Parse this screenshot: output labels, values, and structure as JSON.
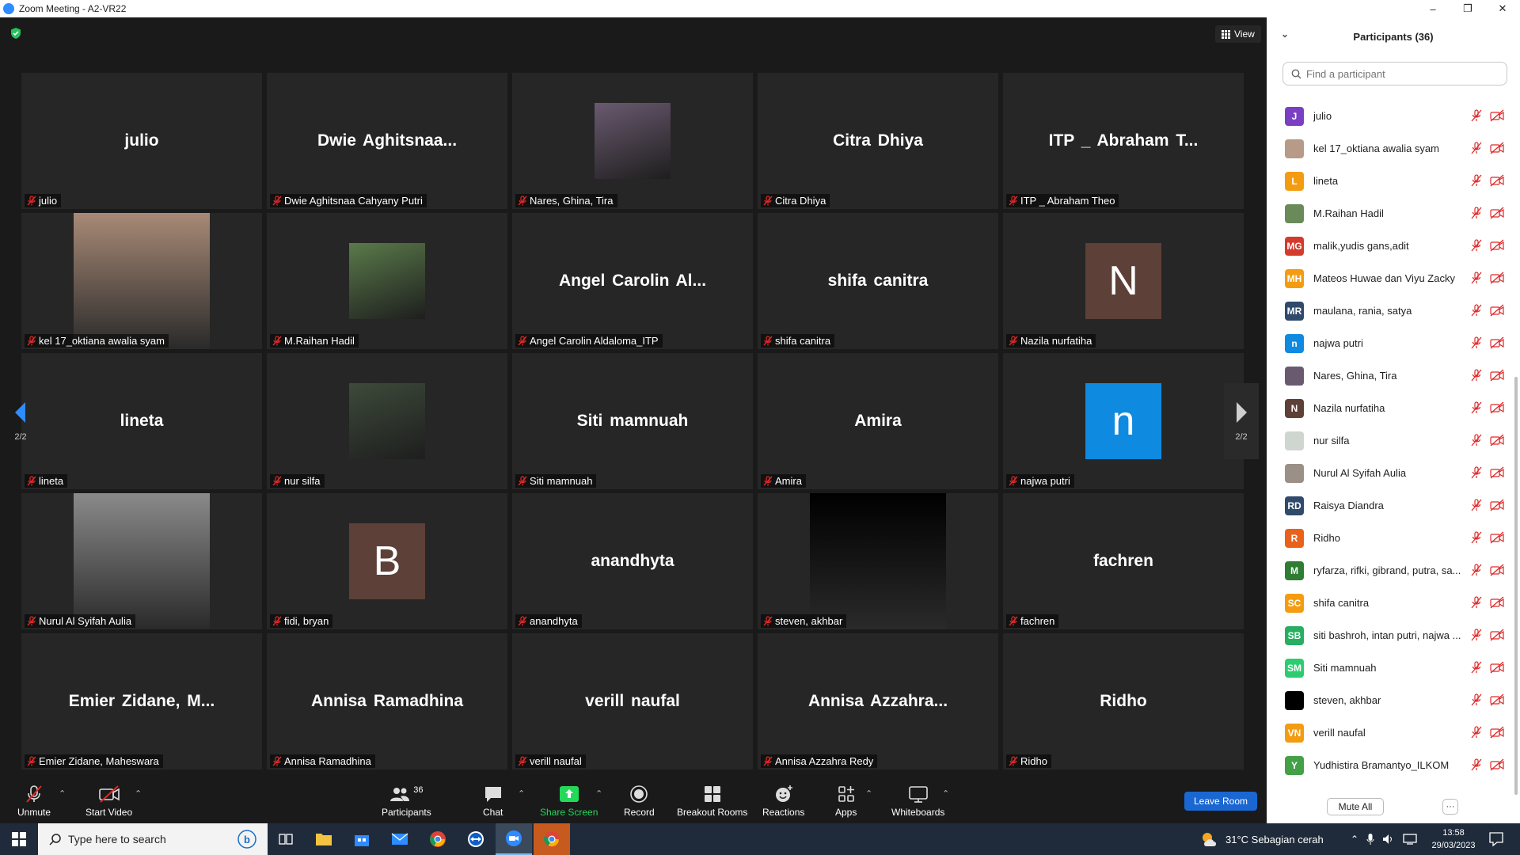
{
  "window": {
    "title": "Zoom Meeting - A2-VR22",
    "minimize": "–",
    "maximize": "❐",
    "close": "✕"
  },
  "view_button": {
    "label": "View"
  },
  "tiles": [
    {
      "display": "julio",
      "caption": "julio",
      "type": "name"
    },
    {
      "display": "Dwie  Aghitsnaa...",
      "caption": "Dwie Aghitsnaa Cahyany Putri",
      "type": "name"
    },
    {
      "display": "",
      "caption": "Nares, Ghina, Tira",
      "type": "thumb",
      "color": "#6a5a70"
    },
    {
      "display": "Citra Dhiya",
      "caption": "Citra Dhiya",
      "type": "name"
    },
    {
      "display": "ITP _ Abraham T...",
      "caption": "ITP _ Abraham Theo",
      "type": "name"
    },
    {
      "display": "",
      "caption": "kel 17_oktiana awalia syam",
      "type": "video",
      "color": "#a88a76"
    },
    {
      "display": "",
      "caption": "M.Raihan Hadil",
      "type": "thumb",
      "color": "#5a7a4a"
    },
    {
      "display": "Angel  Carolin  Al...",
      "caption": "Angel Carolin Aldaloma_ITP",
      "type": "name"
    },
    {
      "display": "shifa canitra",
      "caption": "shifa canitra",
      "type": "name"
    },
    {
      "display": "N",
      "caption": "Nazila nurfatiha",
      "type": "letter",
      "color": "#5d4037"
    },
    {
      "display": "lineta",
      "caption": "lineta",
      "type": "name"
    },
    {
      "display": "",
      "caption": "nur silfa",
      "type": "thumb",
      "color": "#3d4a3a"
    },
    {
      "display": "Siti mamnuah",
      "caption": "Siti mamnuah",
      "type": "name"
    },
    {
      "display": "Amira",
      "caption": "Amira",
      "type": "name"
    },
    {
      "display": "n",
      "caption": "najwa putri",
      "type": "letter",
      "color": "#0e8ae0"
    },
    {
      "display": "",
      "caption": "Nurul Al Syifah Aulia",
      "type": "video",
      "color": "#8a8a8a"
    },
    {
      "display": "B",
      "caption": "fidi, bryan",
      "type": "letter",
      "color": "#5d4037"
    },
    {
      "display": "anandhyta",
      "caption": "anandhyta",
      "type": "name"
    },
    {
      "display": "",
      "caption": "steven, akhbar",
      "type": "video",
      "color": "#000000"
    },
    {
      "display": "fachren",
      "caption": "fachren",
      "type": "name"
    },
    {
      "display": "Emier  Zidane,  M...",
      "caption": "Emier Zidane, Maheswara",
      "type": "name"
    },
    {
      "display": "Annisa Ramadhina",
      "caption": "Annisa Ramadhina",
      "type": "name"
    },
    {
      "display": "verill naufal",
      "caption": "verill naufal",
      "type": "name"
    },
    {
      "display": "Annisa  Azzahra...",
      "caption": "Annisa Azzahra Redy",
      "type": "name"
    },
    {
      "display": "Ridho",
      "caption": "Ridho",
      "type": "name"
    }
  ],
  "pager": {
    "left": "2/2",
    "right": "2/2"
  },
  "toolbar": {
    "unmute": "Unmute",
    "start_video": "Start Video",
    "participants": "Participants",
    "participants_count": "36",
    "chat": "Chat",
    "share_screen": "Share Screen",
    "record": "Record",
    "breakout_rooms": "Breakout Rooms",
    "reactions": "Reactions",
    "apps": "Apps",
    "whiteboards": "Whiteboards",
    "leave": "Leave Room"
  },
  "panel": {
    "title": "Participants (36)",
    "search_placeholder": "Find a participant",
    "participants": [
      {
        "name": "julio",
        "initials": "J",
        "color": "#7b3fc4"
      },
      {
        "name": "kel 17_oktiana awalia syam",
        "initials": "",
        "color": "#b89a88"
      },
      {
        "name": "lineta",
        "initials": "L",
        "color": "#f39c12"
      },
      {
        "name": "M.Raihan Hadil",
        "initials": "",
        "color": "#6a8a5a"
      },
      {
        "name": "malik,yudis gans,adit",
        "initials": "MG",
        "color": "#d33b2c"
      },
      {
        "name": "Mateos Huwae dan Viyu Zacky",
        "initials": "MH",
        "color": "#f39c12"
      },
      {
        "name": "maulana, rania, satya",
        "initials": "MR",
        "color": "#2f4a6b"
      },
      {
        "name": "najwa putri",
        "initials": "n",
        "color": "#0e8ae0"
      },
      {
        "name": "Nares, Ghina, Tira",
        "initials": "",
        "color": "#6a5a70"
      },
      {
        "name": "Nazila nurfatiha",
        "initials": "N",
        "color": "#5d4037"
      },
      {
        "name": "nur silfa",
        "initials": "",
        "color": "#cfd6cf"
      },
      {
        "name": "Nurul Al Syifah Aulia",
        "initials": "",
        "color": "#9a9088"
      },
      {
        "name": "Raisya Diandra",
        "initials": "RD",
        "color": "#2f4a6b"
      },
      {
        "name": "Ridho",
        "initials": "R",
        "color": "#e8621c"
      },
      {
        "name": "ryfarza, rifki, gibrand, putra, sa...",
        "initials": "M",
        "color": "#2e7d32"
      },
      {
        "name": "shifa canitra",
        "initials": "SC",
        "color": "#f39c12"
      },
      {
        "name": "siti bashroh, intan putri, najwa ...",
        "initials": "SB",
        "color": "#27ae60"
      },
      {
        "name": "Siti mamnuah",
        "initials": "SM",
        "color": "#2ecc71"
      },
      {
        "name": "steven, akhbar",
        "initials": "",
        "color": "#000000"
      },
      {
        "name": "verill naufal",
        "initials": "VN",
        "color": "#f39c12"
      },
      {
        "name": "Yudhistira Bramantyo_ILKOM",
        "initials": "Y",
        "color": "#43a047"
      }
    ],
    "mute_all": "Mute All",
    "more": "···"
  },
  "taskbar": {
    "search_placeholder": "Type here to search",
    "weather": "31°C  Sebagian cerah",
    "time": "13:58",
    "date": "29/03/2023"
  },
  "colors": {
    "mic_muted": "#e02828",
    "accent": "#1a67d2",
    "share_green": "#23d959"
  }
}
